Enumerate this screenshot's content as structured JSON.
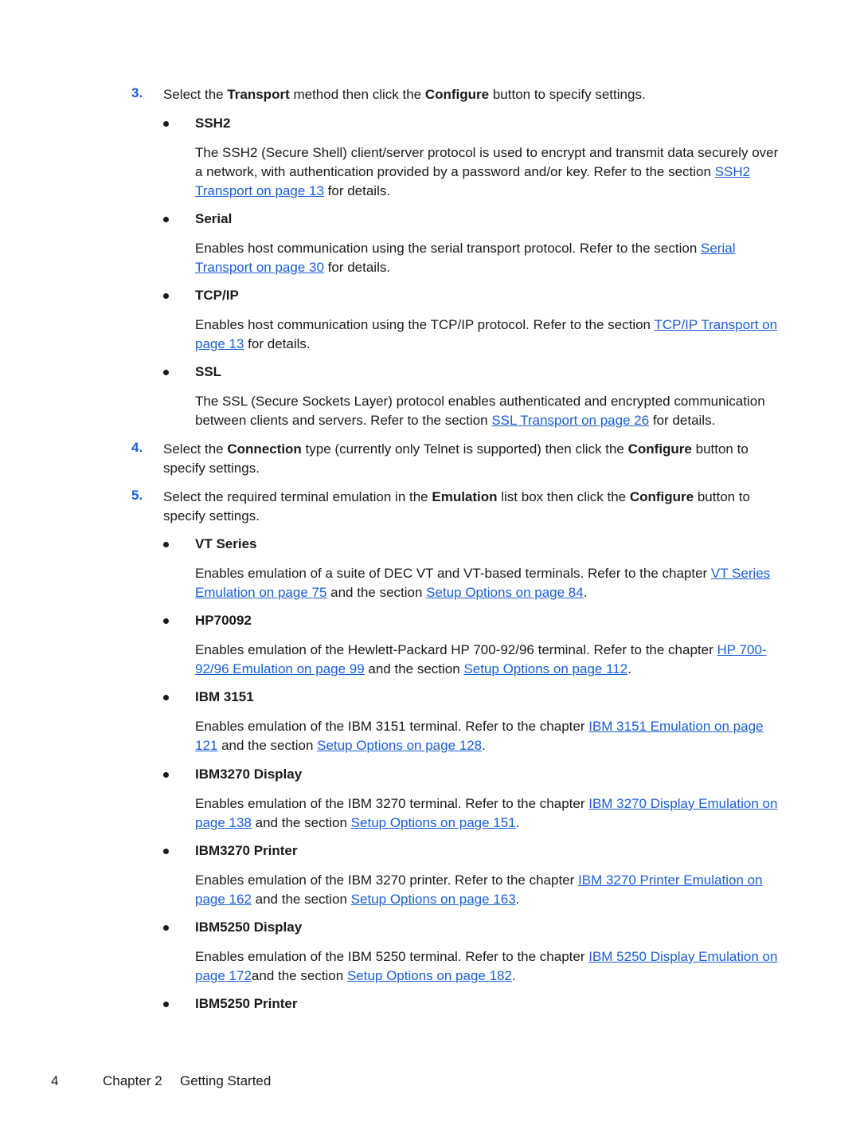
{
  "steps": [
    {
      "num": "3.",
      "parts": [
        "Select the ",
        "Transport",
        " method then click the ",
        "Configure",
        " button to specify settings."
      ]
    },
    {
      "num": "4.",
      "parts": [
        "Select the ",
        "Connection",
        " type (currently only Telnet is supported) then click the ",
        "Configure",
        " button to specify settings."
      ]
    },
    {
      "num": "5.",
      "parts": [
        "Select the required terminal emulation in the ",
        "Emulation",
        " list box then click the ",
        "Configure",
        " button to specify settings."
      ]
    }
  ],
  "transports": [
    {
      "title": "SSH2",
      "text1": "The SSH2 (Secure Shell) client/server protocol is used to encrypt and transmit data securely over a network, with authentication provided by a password and/or key. Refer to the section ",
      "link1": "SSH2 Transport on page 13",
      "text2": " for details."
    },
    {
      "title": "Serial",
      "text1": "Enables host communication using the serial transport protocol. Refer to the section ",
      "link1": "Serial Transport on page 30",
      "text2": " for details."
    },
    {
      "title": "TCP/IP",
      "text1": "Enables host communication using the TCP/IP protocol. Refer to the section ",
      "link1": "TCP/IP Transport on page 13",
      "text2": " for details."
    },
    {
      "title": "SSL",
      "text1": "The SSL (Secure Sockets Layer) protocol enables authenticated and encrypted communication between clients and servers. Refer to the section ",
      "link1": "SSL Transport on page 26",
      "text2": " for details."
    }
  ],
  "emulations": [
    {
      "title": "VT Series",
      "text1": "Enables emulation of a suite of DEC VT and VT-based terminals. Refer to the chapter ",
      "link1": "VT Series Emulation on page 75",
      "text2": " and the section ",
      "link2": "Setup Options on page 84",
      "text3": "."
    },
    {
      "title": "HP70092",
      "text1": "Enables emulation of the Hewlett-Packard HP 700-92/96 terminal. Refer to the chapter ",
      "link1": "HP 700-92/96 Emulation on page 99",
      "text2": " and the section ",
      "link2": "Setup Options on page 112",
      "text3": "."
    },
    {
      "title": "IBM 3151",
      "text1": "Enables emulation of the IBM 3151 terminal. Refer to the chapter ",
      "link1": "IBM 3151 Emulation on page 121",
      "text2": " and the section ",
      "link2": "Setup Options on page 128",
      "text3": "."
    },
    {
      "title": "IBM3270 Display",
      "text1": "Enables emulation of the IBM 3270 terminal. Refer to the chapter ",
      "link1": "IBM 3270 Display Emulation on page 138",
      "text2": " and the section ",
      "link2": "Setup Options on page 151",
      "text3": "."
    },
    {
      "title": "IBM3270 Printer",
      "text1": "Enables emulation of the IBM 3270 printer. Refer to the chapter ",
      "link1": "IBM 3270 Printer Emulation on page 162",
      "text2": " and the section ",
      "link2": "Setup Options on page 163",
      "text3": "."
    },
    {
      "title": "IBM5250 Display",
      "text1": "Enables emulation of the IBM 5250 terminal. Refer to the chapter ",
      "link1": "IBM 5250 Display Emulation on page 172",
      "text2": "and the section ",
      "link2": "Setup Options on page 182",
      "text3": "."
    },
    {
      "title": "IBM5250 Printer"
    }
  ],
  "footer": {
    "page_number": "4",
    "chapter": "Chapter 2",
    "chapter_title": "Getting Started"
  }
}
